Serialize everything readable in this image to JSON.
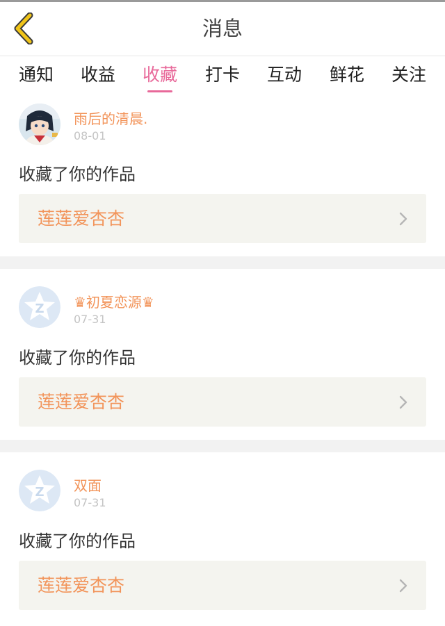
{
  "header": {
    "title": "消息",
    "back_icon": "chevron-left-icon",
    "back_color": "#e6b800"
  },
  "tabs": [
    {
      "label": "通知"
    },
    {
      "label": "收益"
    },
    {
      "label": "收藏"
    },
    {
      "label": "打卡"
    },
    {
      "label": "互动"
    },
    {
      "label": "鲜花"
    },
    {
      "label": "关注"
    }
  ],
  "active_tab": "收藏",
  "colors": {
    "accent_pink": "#e8699a",
    "username_orange": "#f2945a",
    "card_bg": "#f4f4ef",
    "separator_bg": "#f2f2f2"
  },
  "messages": [
    {
      "username": "雨后的清晨.",
      "date": "08-01",
      "action": "收藏了你的作品",
      "work_title": "莲莲爱杏杏",
      "avatar": "anime-avatar"
    },
    {
      "username": "♛初夏恋源♛",
      "date": "07-31",
      "action": "收藏了你的作品",
      "work_title": "莲莲爱杏杏",
      "avatar": "default-avatar"
    },
    {
      "username": "双面",
      "date": "07-31",
      "action": "收藏了你的作品",
      "work_title": "莲莲爱杏杏",
      "avatar": "default-avatar"
    }
  ]
}
